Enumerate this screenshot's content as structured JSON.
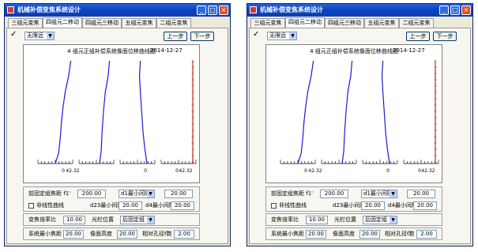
{
  "window": {
    "title": "机械补偿变焦系统设计"
  },
  "tabs": [
    "三组元变焦",
    "四组元二移动",
    "四组元三移动",
    "五组元变焦",
    "二组元变焦"
  ],
  "active_tab": "四组元二移动",
  "toolbar": {
    "dropdown_value": "无限远",
    "prev_label": "上一步",
    "next_label": "下一步"
  },
  "plot": {
    "title": "4 组元正组补偿系统像面位移曲线图",
    "date": "2014-12-27",
    "tick_zero": "0",
    "tick_max": "42.32"
  },
  "row1": {
    "front_label": "前固定组焦距 f1'",
    "front_value": "200.00",
    "select_value": "d1最小间隔",
    "right_value": "20.00"
  },
  "row2": {
    "nonlinear_label": "非线性曲线",
    "d23_label": "d23最小间隔",
    "d23_value": "20.00",
    "d4_label": "d4最小间隔",
    "d4_value": "20.00"
  },
  "row3": {
    "zoom_label": "变焦倍率比",
    "zoom_value": "10.00",
    "stop_label": "光栏位置",
    "stop_value": "后固定组"
  },
  "row4": {
    "min_label": "系统最小焦距",
    "min_value": "20.00",
    "height_label": "像面高度",
    "height_value": "20.00",
    "aperture_label": "相对孔径f数",
    "aperture_value": "2.00"
  },
  "chart_data": {
    "type": "line",
    "title": "4 组元正组补偿系统像面位移曲线图",
    "x_range": [
      0,
      42.32
    ],
    "series": [
      {
        "values": [
          [
            0,
            0
          ],
          [
            0.6,
            0.1
          ],
          [
            0.9,
            0.25
          ],
          [
            1.1,
            0.4
          ],
          [
            1.4,
            0.55
          ],
          [
            1.8,
            0.7
          ],
          [
            2.4,
            0.85
          ],
          [
            2.8,
            1
          ]
        ]
      },
      {
        "values": [
          [
            0,
            0
          ],
          [
            0.3,
            0.12
          ],
          [
            0.45,
            0.3
          ],
          [
            0.7,
            0.5
          ],
          [
            1.05,
            0.7
          ],
          [
            1.55,
            0.85
          ],
          [
            1.8,
            1
          ]
        ]
      },
      {
        "values": [
          [
            0,
            0
          ],
          [
            -0.4,
            0.15
          ],
          [
            -0.7,
            0.3
          ],
          [
            -0.95,
            0.5
          ],
          [
            -1.2,
            0.7
          ],
          [
            -1.35,
            0.85
          ],
          [
            -1.2,
            1
          ]
        ]
      },
      {
        "values": [
          [
            0,
            0
          ],
          [
            0,
            1
          ]
        ]
      }
    ],
    "colors": [
      "#1a1adc",
      "#1a1adc",
      "#1a1adc",
      "#c0281e"
    ]
  }
}
